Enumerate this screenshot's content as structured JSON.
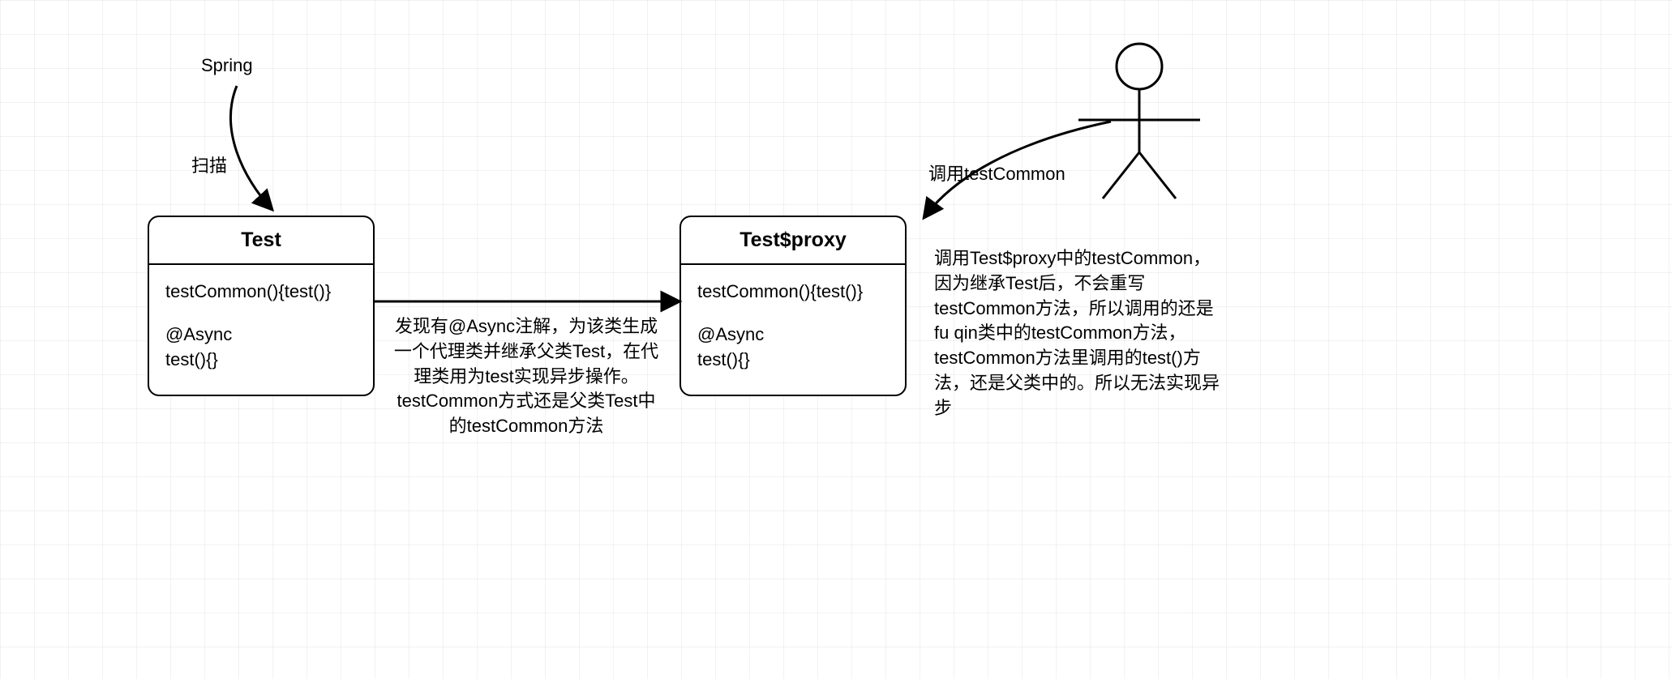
{
  "spring_label": "Spring",
  "scan_label": "扫描",
  "class_test": {
    "title": "Test",
    "method1": "testCommon(){test()}",
    "annotation": "@Async",
    "method2": "test(){}"
  },
  "class_proxy": {
    "title": "Test$proxy",
    "method1": "testCommon(){test()}",
    "annotation": "@Async",
    "method2": "test(){}"
  },
  "center_note": "发现有@Async注解，为该类生成一个代理类并继承父类Test，在代理类用为test实现异步操作。testCommon方式还是父类Test中的testCommon方法",
  "call_label": "调用testCommon",
  "right_note": "调用Test$proxy中的testCommon，因为继承Test后，不会重写testCommon方法，所以调用的还是fu qin类中的testCommon方法，testCommon方法里调用的test()方法，还是父类中的。所以无法实现异步"
}
